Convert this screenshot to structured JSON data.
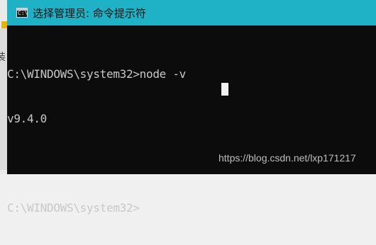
{
  "window": {
    "title": "选择管理员: 命令提示符",
    "icon": "cmd-icon",
    "icon_text": "C:\\",
    "titlebar_color": "#1fb1c5",
    "background": "#0c0c0c",
    "text_color": "#c8c8c8"
  },
  "console": {
    "lines": [
      "C:\\WINDOWS\\system32>node -v",
      "v9.4.0",
      "",
      "C:\\WINDOWS\\system32>"
    ]
  },
  "backdrop": {
    "glyph": "装"
  },
  "watermark": "https://blog.csdn.net/lxp171217"
}
